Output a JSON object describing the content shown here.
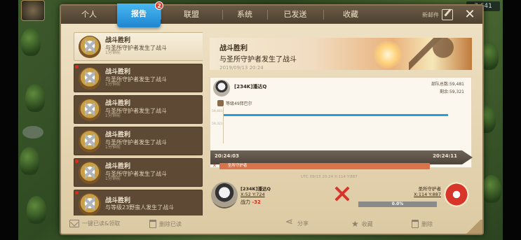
{
  "hud": {
    "resource_value": "7,641"
  },
  "tabs": [
    {
      "label": "个人",
      "active": false
    },
    {
      "label": "报告",
      "active": true,
      "badge": "2"
    },
    {
      "label": "联盟",
      "active": false
    },
    {
      "label": "系统",
      "active": false
    },
    {
      "label": "已发送",
      "active": false
    },
    {
      "label": "收藏",
      "active": false
    }
  ],
  "header": {
    "new_mail_label": "新邮件",
    "close_glyph": "✕"
  },
  "reports": [
    {
      "title": "战斗胜利",
      "subtitle": "与圣所守护者发生了战斗",
      "time": "1分钟前",
      "selected": true,
      "unread": false
    },
    {
      "title": "战斗胜利",
      "subtitle": "与圣所守护者发生了战斗",
      "time": "1分钟前",
      "selected": false,
      "unread": true
    },
    {
      "title": "战斗胜利",
      "subtitle": "与圣所守护者发生了战斗",
      "time": "1分钟前",
      "selected": false,
      "unread": false
    },
    {
      "title": "战斗胜利",
      "subtitle": "与圣所守护者发生了战斗",
      "time": "1分钟前",
      "selected": false,
      "unread": false
    },
    {
      "title": "战斗胜利",
      "subtitle": "与圣所守护者发生了战斗",
      "time": "1分钟前",
      "selected": false,
      "unread": true
    },
    {
      "title": "战斗胜利",
      "subtitle": "与等级23野蛮人发生了战斗",
      "time": "",
      "selected": false,
      "unread": true
    }
  ],
  "detail": {
    "title": "战斗胜利",
    "subtitle": "与圣所守护者发生了战斗",
    "date": "2019/09/13 20:24",
    "player_name": "[234K]潘达Q",
    "troops_total_label": "部队总数:59,481",
    "troops_remaining_label": "剩余:59,321",
    "level_label": "等级49拜巴尔",
    "y_marks": [
      "59,481",
      "59,321"
    ],
    "time_start": "20:24:03",
    "time_end": "20:24:11",
    "enemy_marker": "✕",
    "enemy_bar_label": "圣所守护者",
    "battle": {
      "meta": "UTC 09/13 20:24   X:114 Y:887",
      "left_name": "[234K]潘达Q",
      "left_coord": "X:52 Y:724",
      "power_label": "战力",
      "power_value": "-32",
      "right_name": "圣所守护者",
      "right_coord": "X:114 Y:887",
      "right_bar_value": "0.0%"
    }
  },
  "footer": {
    "read_claim_all": "一键已读&领取",
    "delete_read": "删除已读",
    "share": "分享",
    "favorite": "收藏",
    "delete": "删除"
  },
  "colors": {
    "tab_active": "#2a9fe2",
    "troop_line": "#2a9fd6",
    "enemy_bar": "#d9744a",
    "power_loss": "#d22a1a",
    "swords": "#d8342a"
  }
}
